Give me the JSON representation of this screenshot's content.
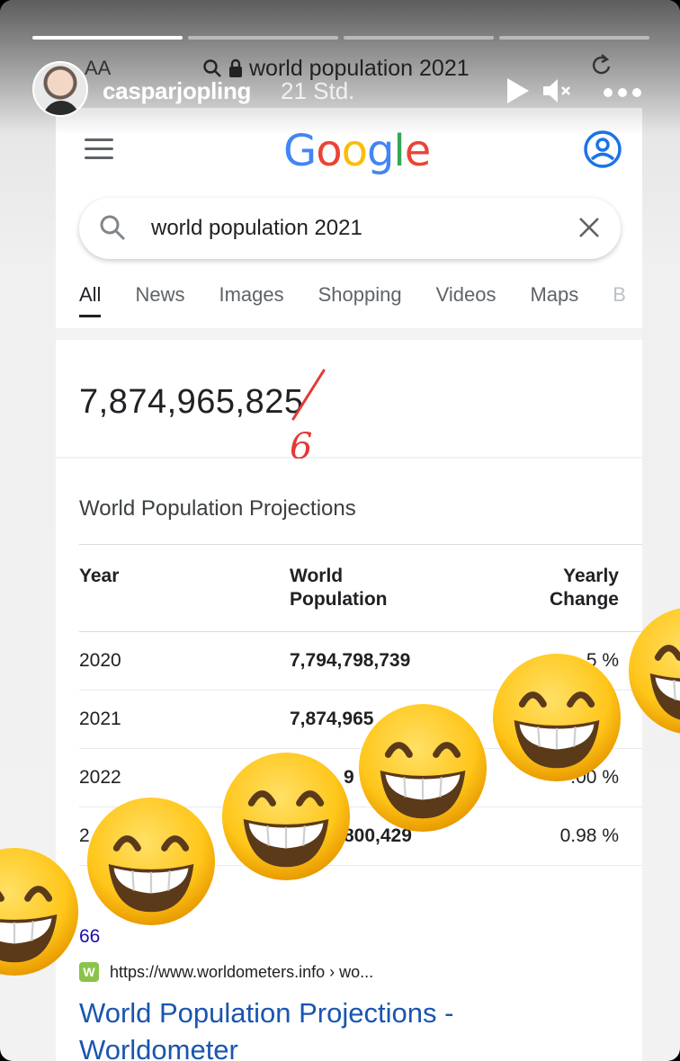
{
  "story": {
    "username": "casparjopling",
    "time": "21 Std.",
    "progress": [
      1.0,
      0.0,
      0.0,
      0.0
    ]
  },
  "browser": {
    "aa_label": "AA",
    "url_text": "world population 2021"
  },
  "google": {
    "logo": [
      "G",
      "o",
      "o",
      "g",
      "l",
      "e"
    ],
    "logo_colors": [
      "#4285F4",
      "#EA4335",
      "#FBBC05",
      "#4285F4",
      "#34A853",
      "#EA4335"
    ],
    "search_query": "world population 2021",
    "tabs": [
      {
        "label": "All",
        "active": true
      },
      {
        "label": "News"
      },
      {
        "label": "Images"
      },
      {
        "label": "Shopping"
      },
      {
        "label": "Videos"
      },
      {
        "label": "Maps"
      },
      {
        "label": "B"
      }
    ]
  },
  "population": {
    "value": "7,874,965,825",
    "correction": "6"
  },
  "projections": {
    "title": "World Population Projections",
    "headers": [
      "Year",
      "World\nPopulation",
      "Yearly Change"
    ],
    "rows": [
      {
        "year": "2020",
        "population": "7,794,798,739",
        "change": "5 %"
      },
      {
        "year": "2021",
        "population": "7,874,965",
        "change": ""
      },
      {
        "year": "2022",
        "population": "9",
        "change": ".00 %"
      },
      {
        "year": "2",
        "population": "800,429",
        "change": "0.98 %"
      }
    ],
    "more_link": "66"
  },
  "result": {
    "source_url": "https://www.worldometers.info › wo...",
    "favicon": "W",
    "title": "World Population Projections - Worldometer"
  },
  "emoji": {
    "name": "grinning-face-with-smiling-eyes",
    "count": 6
  }
}
